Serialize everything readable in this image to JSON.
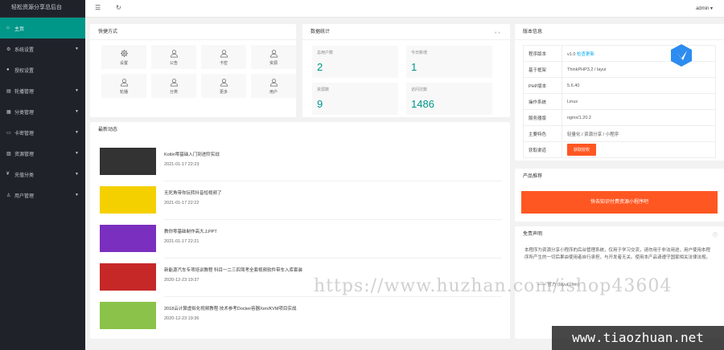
{
  "sidebar": {
    "title": "轻松资源分享总后台",
    "items": [
      {
        "label": "主页",
        "icon": "home-icon",
        "glyph": "⌂",
        "active": true,
        "caret": false
      },
      {
        "label": "系统设置",
        "icon": "gear-icon",
        "glyph": "⚙",
        "active": false,
        "caret": true
      },
      {
        "label": "授权设置",
        "icon": "dot-icon",
        "glyph": "●",
        "active": false,
        "caret": false
      },
      {
        "label": "轮播管理",
        "icon": "slides-icon",
        "glyph": "▤",
        "active": false,
        "caret": true
      },
      {
        "label": "分类管理",
        "icon": "category-icon",
        "glyph": "▦",
        "active": false,
        "caret": true
      },
      {
        "label": "卡密管理",
        "icon": "card-icon",
        "glyph": "▭",
        "active": false,
        "caret": true
      },
      {
        "label": "资源管理",
        "icon": "resource-icon",
        "glyph": "▧",
        "active": false,
        "caret": true
      },
      {
        "label": "充值分类",
        "icon": "money-icon",
        "glyph": "¥",
        "active": false,
        "caret": true
      },
      {
        "label": "用户管理",
        "icon": "user-icon",
        "glyph": "♙",
        "active": false,
        "caret": true
      }
    ]
  },
  "header": {
    "menu_icon": "☰",
    "refresh_icon": "↻",
    "user": "admin ▾"
  },
  "quick": {
    "title": "快捷方式",
    "items": [
      {
        "label": "设置",
        "icon": "gear-icon"
      },
      {
        "label": "公告",
        "icon": "user-icon"
      },
      {
        "label": "卡密",
        "icon": "user-icon"
      },
      {
        "label": "资源",
        "icon": "user-icon"
      },
      {
        "label": "轮播",
        "icon": "user-icon"
      },
      {
        "label": "分类",
        "icon": "user-icon"
      },
      {
        "label": "更多",
        "icon": "user-icon"
      },
      {
        "label": "用户",
        "icon": "user-icon"
      }
    ]
  },
  "stats": {
    "title": "数据统计",
    "items": [
      {
        "label": "总用户数",
        "value": "2"
      },
      {
        "label": "今日新增",
        "value": "1"
      },
      {
        "label": "资源数",
        "value": "9"
      },
      {
        "label": "访问次数",
        "value": "1486"
      }
    ]
  },
  "news": {
    "title": "最新动态",
    "items": [
      {
        "title": "Kotlin零基础入门到进阶实战",
        "date": "2021-01-17 22:23",
        "thumb": "#333"
      },
      {
        "title": "无死角带你玩转抖音短视频了",
        "date": "2021-01-17 22:22",
        "thumb": "#f5d000"
      },
      {
        "title": "教你零基础制作高大上PPT",
        "date": "2021-01-17 22:21",
        "thumb": "#7b2fbf"
      },
      {
        "title": "新能源汽车专项培训教程 科目一二三四驾考全套视频软件带车入库套装",
        "date": "2020-12-23 19:37",
        "thumb": "#c62828"
      },
      {
        "title": "2018云计算虚拟化视频教程 技术参考Docker容器Xen/KVM项目实战",
        "date": "2020-12-23 19:36",
        "thumb": "#8bc34a"
      }
    ]
  },
  "info": {
    "title": "版本信息",
    "rows": [
      {
        "k": "程序版本",
        "v": "v1.0",
        "link": "检查更新"
      },
      {
        "k": "基于框架",
        "v": "ThinkPHP3.2 / layui"
      },
      {
        "k": "PHP版本",
        "v": "5.6.40"
      },
      {
        "k": "操作系统",
        "v": "Linux"
      },
      {
        "k": "服务器版",
        "v": "nginx/1.20.2"
      },
      {
        "k": "主要特色",
        "v": "轻量化 / 资源分享 / 小程序"
      },
      {
        "k": "获取渠道",
        "v": "",
        "button": "获取授权"
      }
    ]
  },
  "promo": {
    "title": "产品推荐",
    "button": "快去知识付费资源小程序吧"
  },
  "notice": {
    "title": "免责声明",
    "text": "本程序为资源分享小程序的后台管理系统，仅用于学习交流，请勿用于非法用途，用户使用本程序所产生的一切后果由使用者自行承担，与开发者无关。使用本产品请遵守国家相关法律法规。",
    "sign": "—— 官方 (layui.com)"
  },
  "watermarks": {
    "url": "https://www.huzhan.com/ishop43604",
    "site": "www.tiaozhuan.net"
  }
}
